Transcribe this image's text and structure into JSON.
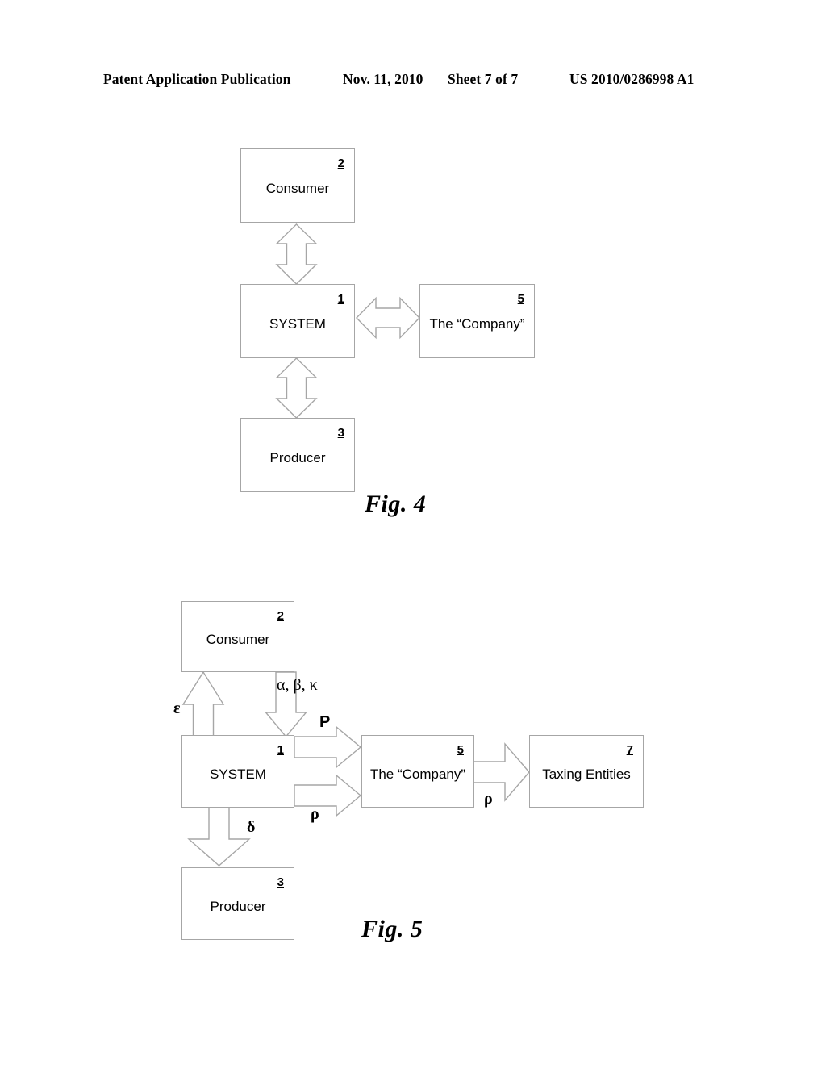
{
  "header": {
    "publication": "Patent Application Publication",
    "date": "Nov. 11, 2010",
    "sheet": "Sheet 7 of 7",
    "patent_number": "US 2010/0286998 A1"
  },
  "style": {
    "box_stroke": "#a6a6a6",
    "arrow_stroke": "#a6a6a6",
    "text_color": "#000000",
    "page_background": "#ffffff"
  },
  "figures": [
    {
      "id": "figure-4",
      "caption": "Fig. 4",
      "nodes": [
        {
          "key": "consumer",
          "label": "Consumer",
          "ref": "2"
        },
        {
          "key": "system",
          "label": "SYSTEM",
          "ref": "1"
        },
        {
          "key": "company",
          "label": "The “Company”",
          "ref": "5"
        },
        {
          "key": "producer",
          "label": "Producer",
          "ref": "3"
        }
      ],
      "edges": [
        {
          "key": "consumer-system",
          "from": "consumer",
          "to": "system",
          "direction": "bidirectional",
          "orientation": "vertical",
          "label": ""
        },
        {
          "key": "system-company",
          "from": "system",
          "to": "company",
          "direction": "bidirectional",
          "orientation": "horizontal",
          "label": ""
        },
        {
          "key": "system-producer",
          "from": "system",
          "to": "producer",
          "direction": "bidirectional",
          "orientation": "vertical",
          "label": ""
        }
      ]
    },
    {
      "id": "figure-5",
      "caption": "Fig. 5",
      "nodes": [
        {
          "key": "consumer",
          "label": "Consumer",
          "ref": "2"
        },
        {
          "key": "system",
          "label": "SYSTEM",
          "ref": "1"
        },
        {
          "key": "company",
          "label": "The “Company”",
          "ref": "5"
        },
        {
          "key": "taxing",
          "label": "Taxing Entities",
          "ref": "7"
        },
        {
          "key": "producer",
          "label": "Producer",
          "ref": "3"
        }
      ],
      "edges": [
        {
          "key": "system-consumer",
          "from": "system",
          "to": "consumer",
          "direction": "up",
          "label": "ε"
        },
        {
          "key": "consumer-system",
          "from": "consumer",
          "to": "system",
          "direction": "down",
          "label": "α, β, κ"
        },
        {
          "key": "system-company-p",
          "from": "system",
          "to": "company",
          "direction": "right",
          "label": "P"
        },
        {
          "key": "system-company-r",
          "from": "system",
          "to": "company",
          "direction": "right",
          "label": "ρ"
        },
        {
          "key": "company-taxing",
          "from": "company",
          "to": "taxing",
          "direction": "right",
          "label": "ρ"
        },
        {
          "key": "system-producer",
          "from": "system",
          "to": "producer",
          "direction": "down",
          "label": "δ"
        }
      ]
    }
  ]
}
